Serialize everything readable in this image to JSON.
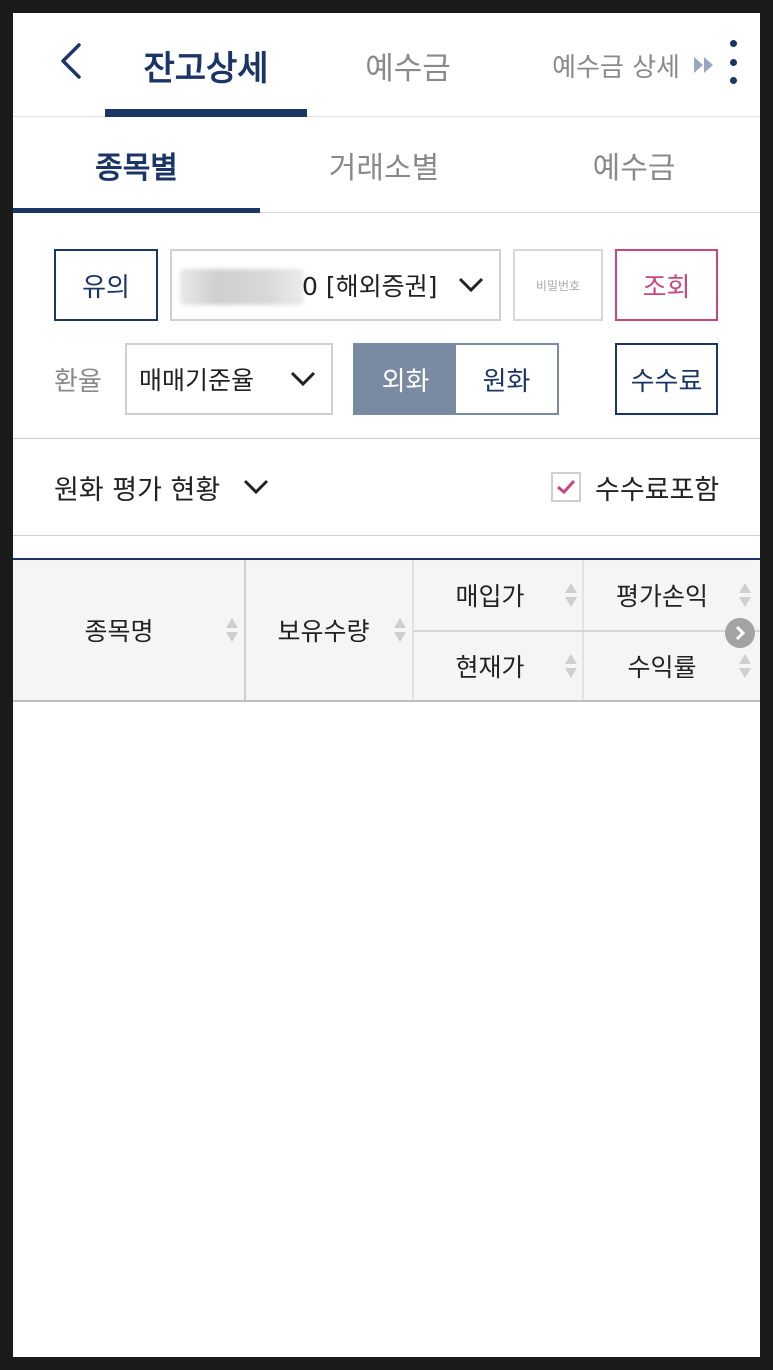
{
  "header": {
    "tabs": [
      {
        "label": "잔고상세"
      },
      {
        "label": "예수금"
      },
      {
        "label": "예수금 상세"
      }
    ]
  },
  "subtabs": [
    {
      "label": "종목별"
    },
    {
      "label": "거래소별"
    },
    {
      "label": "예수금"
    }
  ],
  "controls": {
    "notice_label": "유의",
    "account_text": "0 [해외증권]",
    "password_placeholder": "비밀번호",
    "query_label": "조회",
    "rate_label": "환율",
    "rate_value": "매매기준율",
    "currency_options": [
      "외화",
      "원화"
    ],
    "currency_selected": "외화",
    "fee_label": "수수료"
  },
  "summary": {
    "dropdown_label": "원화 평가 현황",
    "fee_include_label": "수수료포함",
    "fee_include_checked": true
  },
  "table": {
    "headers": {
      "name": "종목명",
      "quantity": "보유수량",
      "buy_price": "매입가",
      "current_price": "현재가",
      "pnl": "평가손익",
      "return_rate": "수익률"
    },
    "rows": []
  },
  "colors": {
    "navy": "#1b3566",
    "pink": "#c9467e",
    "toggle": "#7b8aa3"
  }
}
